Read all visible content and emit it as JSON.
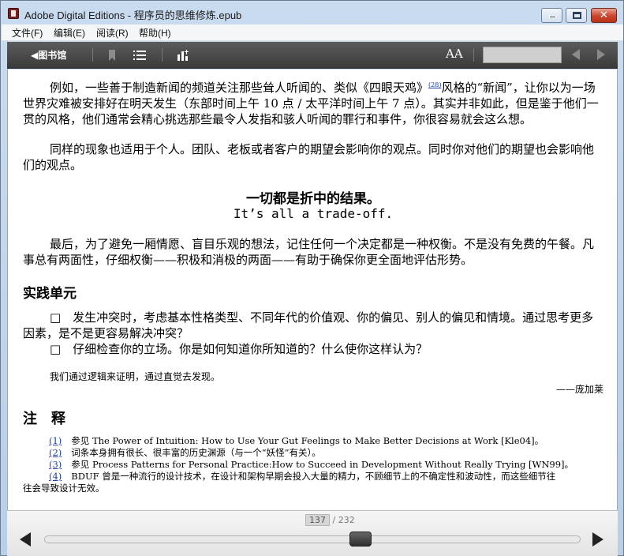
{
  "window": {
    "title": "Adobe Digital Editions - 程序员的思维修炼.epub",
    "close_glyph": "✕"
  },
  "menu": [
    "文件(F)",
    "编辑(E)",
    "阅读(R)",
    "帮助(H)"
  ],
  "toolbar": {
    "library_label": "◀图书馆",
    "font_size_label": "AA",
    "icons": [
      "bookmark-icon",
      "list-icon",
      "chart-icon",
      "prev-icon",
      "next-icon"
    ]
  },
  "content": {
    "p1_a": "例如，一些善于制造新闻的频道关注那些耸人听闻的、类似《四眼天鸡》",
    "p1_sup": "(28)",
    "p1_b": "风格的“新闻”，让你以为一场世界灾难被安排好在明天发生（东部时间上午 10 点 / 太平洋时间上午 7 点）。其实并非如此，但是鉴于他们一贯的风格，他们通常会精心挑选那些最令人发指和骇人听闻的罪行和事件，你很容易就会这么想。",
    "p2": "同样的现象也适用于个人。团队、老板或者客户的期望会影响你的观点。同时你对他们的期望也会影响他们的观点。",
    "center_cn": "一切都是折中的结果。",
    "center_en": "It’s all a trade-off.",
    "p3": "最后，为了避免一厢情愿、盲目乐观的想法，记住任何一个决定都是一种权衡。不是没有免费的午餐。凡事总有两面性，仔细权衡——积极和消极的两面——有助于确保你更全面地评估形势。",
    "section_title": "实践单元",
    "check1": "□　发生冲突时，考虑基本性格类型、不同年代的价值观、你的偏见、别人的偏见和情境。通过思考更多因素，是不是更容易解决冲突？",
    "check2": "□　仔细检查你的立场。你是如何知道你所知道的？什么使你这样认为？",
    "quote": "我们通过逻辑来证明，通过直觉去发现。",
    "quote_author": "——庞加莱",
    "notes_title": "注　释",
    "notes": [
      {
        "link": "(1)",
        "text": "参见 The Power of Intuition: How to Use Your Gut Feelings to Make Better Decisions at Work [Kle04]。"
      },
      {
        "link": "(2)",
        "text": "词条本身拥有很长、很丰富的历史渊源（与一个“妖怪”有关）。"
      },
      {
        "link": "(3)",
        "text": "参见 Process Patterns for Personal Practice:How to Succeed in Development Without Really Trying [WN99]。"
      },
      {
        "link": "(4)",
        "text": "BDUF 曾是一种流行的设计技术，在设计和架构早期会投入大量的精力，不顾细节上的不确定性和波动性，而这些细节往"
      }
    ],
    "note4_cont": "往会导致设计无效。"
  },
  "pager": {
    "current": "137",
    "total": "/ 232",
    "progress": 0.59
  }
}
